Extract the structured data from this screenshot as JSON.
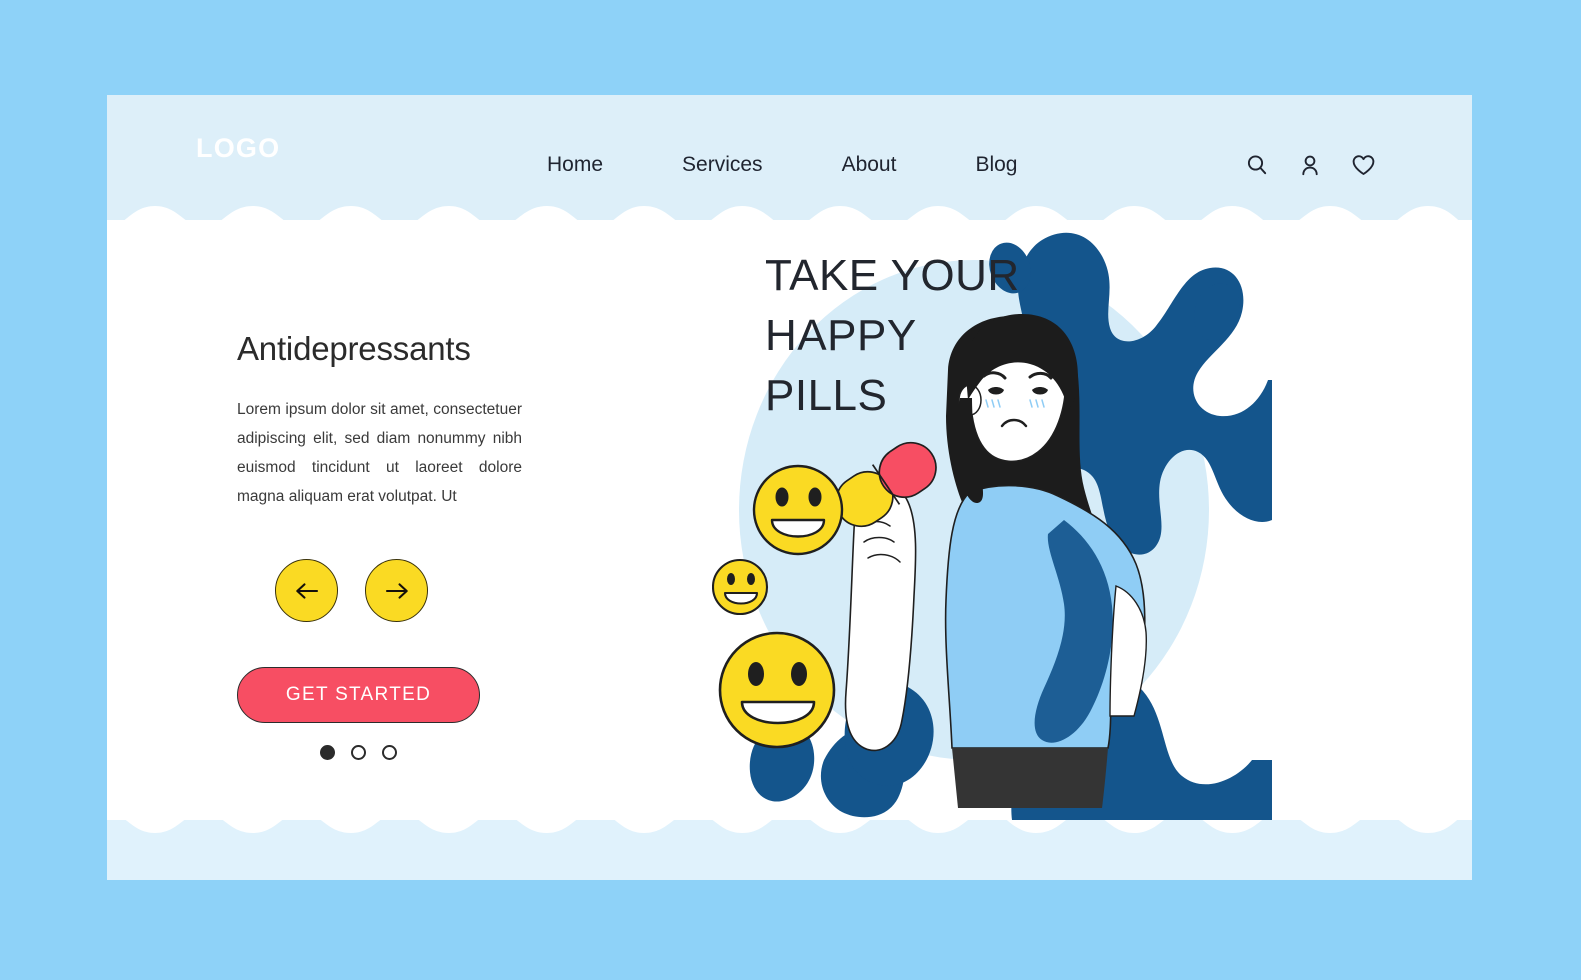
{
  "page": {
    "outer_background": "#8ed2f8",
    "panel_background": "#e0f2fc",
    "header_background": "#ddeff9",
    "body_background": "#ffffff"
  },
  "header": {
    "logo": "LOGO",
    "nav": [
      {
        "label": "Home"
      },
      {
        "label": "Services"
      },
      {
        "label": "About"
      },
      {
        "label": "Blog"
      }
    ],
    "icons": [
      {
        "name": "search-icon"
      },
      {
        "name": "user-icon"
      },
      {
        "name": "heart-icon"
      }
    ]
  },
  "hero": {
    "heading": "Antidepressants",
    "paragraph": "Lorem ipsum dolor sit amet, consectetuer adipiscing elit, sed diam nonummy nibh euismod tincidunt ut laoreet dolore magna aliquam erat volutpat. Ut",
    "prev_arrow": "←",
    "next_arrow": "→",
    "cta_label": "GET STARTED",
    "carousel": {
      "total": 3,
      "active_index": 0
    }
  },
  "illustration": {
    "headline_lines": [
      "TAKE YOUR",
      "HAPPY",
      "PILLS"
    ],
    "colors": {
      "backdrop_circle": "#d6ecf8",
      "splash_navy": "#14558c",
      "splash_navy_dark": "#0f4b7e",
      "shirt_blue": "#8fcdf5",
      "smiley_yellow": "#fada23",
      "pill_yellow": "#fada23",
      "pill_pink": "#f74e63",
      "hair_dark": "#1c1c1c",
      "skin_white": "#ffffff",
      "outline": "#1f1f1f",
      "shorts_dark": "#343434"
    },
    "elements": [
      {
        "name": "smiley-face-medium"
      },
      {
        "name": "smiley-face-small"
      },
      {
        "name": "smiley-face-large"
      },
      {
        "name": "capsule-pill"
      },
      {
        "name": "woman-character"
      }
    ]
  },
  "accent_colors": {
    "yellow": "#fada23",
    "pink": "#f74e63",
    "navy": "#14558c",
    "sky": "#8ed2f8"
  }
}
